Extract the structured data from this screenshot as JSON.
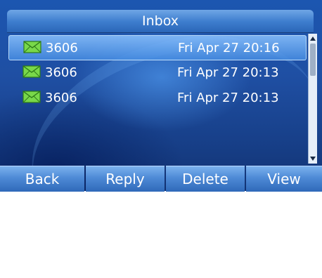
{
  "title": "Inbox",
  "messages": [
    {
      "sender": "3606",
      "datetime": "Fri Apr 27 20:16",
      "selected": true,
      "icon": "envelope-icon"
    },
    {
      "sender": "3606",
      "datetime": "Fri Apr 27 20:13",
      "selected": false,
      "icon": "envelope-icon"
    },
    {
      "sender": "3606",
      "datetime": "Fri Apr 27 20:13",
      "selected": false,
      "icon": "envelope-icon"
    }
  ],
  "softkeys": {
    "back": "Back",
    "reply": "Reply",
    "delete": "Delete",
    "view": "View"
  },
  "colors": {
    "accent": "#3f7fcf",
    "background": "#1f4fa3",
    "envelope": "#6fd33a"
  }
}
